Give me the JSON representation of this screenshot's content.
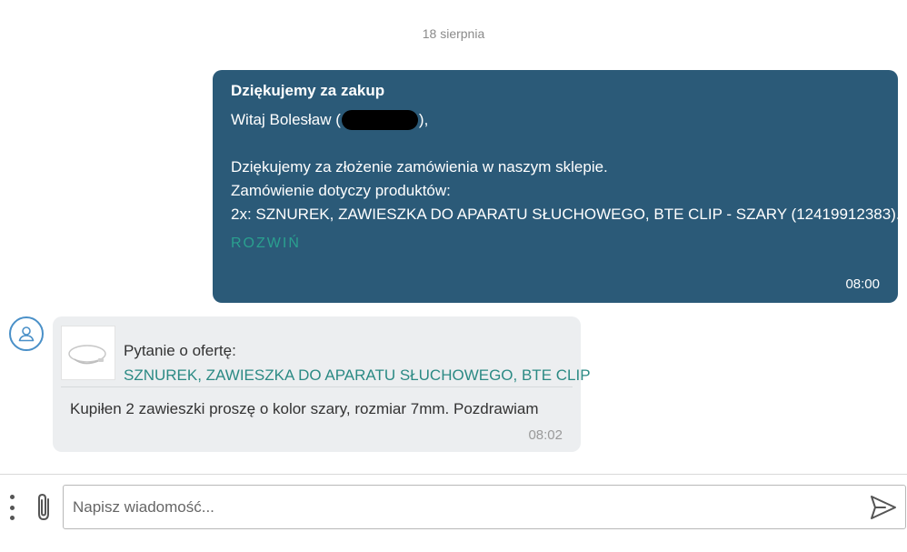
{
  "conversation": {
    "date_separator": "18 sierpnia"
  },
  "outgoing_message": {
    "title": "Dziękujemy za zakup",
    "greeting_prefix": "Witaj Bolesław (",
    "greeting_suffix": "),",
    "body_line_1": "Dziękujemy za złożenie zamówienia w naszym sklepie.",
    "body_line_2": "Zamówienie dotyczy produktów:",
    "body_line_3": "2x: SZNUREK, ZAWIESZKA DO APARATU SŁUCHOWEGO, BTE CLIP - SZARY (12419912383)...",
    "expand_label": "ROZWIŃ",
    "time": "08:00"
  },
  "incoming_message": {
    "offer_label": "Pytanie o ofertę:",
    "offer_link": "SZNUREK, ZAWIESZKA DO APARATU SŁUCHOWEGO, BTE CLIP",
    "text": "Kupiłen 2 zawieszki proszę o kolor szary, rozmiar 7mm. Pozdrawiam",
    "time": "08:02"
  },
  "composer": {
    "placeholder": "Napisz wiadomość..."
  },
  "colors": {
    "outgoing_bg": "#2b5a78",
    "accent_teal": "#2aa08f",
    "incoming_bg": "#eceef0"
  }
}
